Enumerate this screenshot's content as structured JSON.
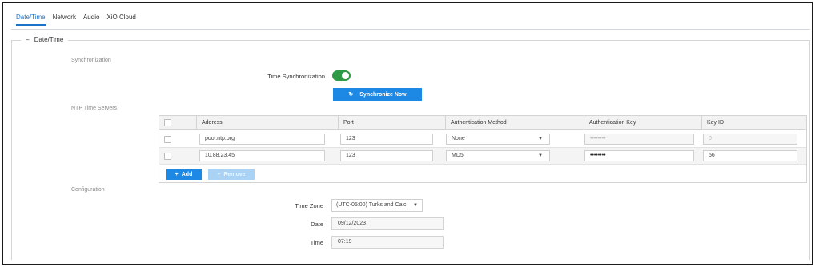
{
  "tabs": [
    {
      "label": "Date/Time"
    },
    {
      "label": "Network"
    },
    {
      "label": "Audio"
    },
    {
      "label": "XiO Cloud"
    }
  ],
  "panel": {
    "legend": "Date/Time",
    "collapse_symbol": "–"
  },
  "synchronization": {
    "section_label": "Synchronization",
    "time_sync_label": "Time Synchronization",
    "time_sync_on": true,
    "sync_now_label": "Synchronize Now",
    "sync_icon": "refresh-icon"
  },
  "ntp": {
    "section_label": "NTP Time Servers",
    "columns": [
      "Address",
      "Port",
      "Authentication Method",
      "Authentication Key",
      "Key ID"
    ],
    "rows": [
      {
        "address": "pool.ntp.org",
        "port": "123",
        "auth_method": "None",
        "auth_key": "••••••••",
        "key_id": "0"
      },
      {
        "address": "10.88.23.45",
        "port": "123",
        "auth_method": "MD5",
        "auth_key": "••••••••",
        "key_id": "56"
      }
    ],
    "add_label": "Add",
    "remove_label": "Remove"
  },
  "configuration": {
    "section_label": "Configuration",
    "timezone_label": "Time Zone",
    "timezone_value": "(UTC-05:00) Turks and Caic",
    "date_label": "Date",
    "date_value": "09/12/2023",
    "time_label": "Time",
    "time_value": "07:19"
  },
  "colors": {
    "accent": "#1e88e5",
    "toggle_on": "#2e9a45"
  }
}
